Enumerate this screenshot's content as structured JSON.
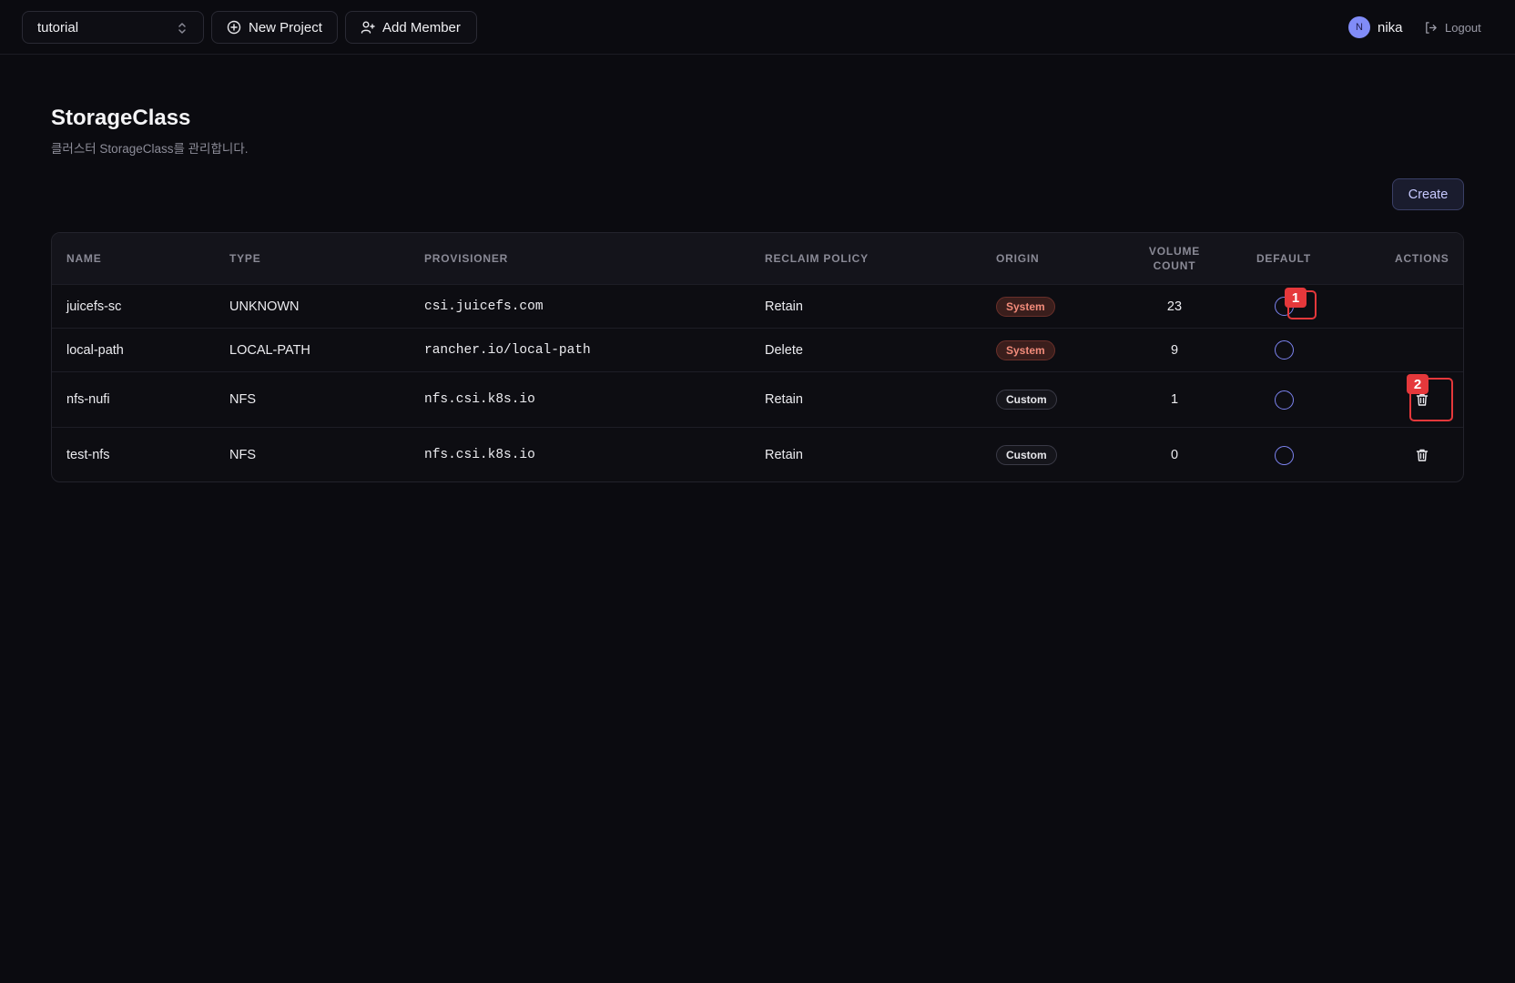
{
  "topbar": {
    "project_select": "tutorial",
    "new_project_label": "New Project",
    "add_member_label": "Add Member",
    "user_initial": "N",
    "user_name": "nika",
    "logout_label": "Logout"
  },
  "page": {
    "title": "StorageClass",
    "subtitle": "클러스터 StorageClass를 관리합니다.",
    "create_label": "Create"
  },
  "table": {
    "headers": {
      "name": "NAME",
      "type": "TYPE",
      "provisioner": "PROVISIONER",
      "reclaim_policy": "RECLAIM POLICY",
      "origin": "ORIGIN",
      "volume_count_line1": "VOLUME",
      "volume_count_line2": "COUNT",
      "default": "DEFAULT",
      "actions": "ACTIONS"
    },
    "rows": [
      {
        "name": "juicefs-sc",
        "type": "UNKNOWN",
        "provisioner": "csi.juicefs.com",
        "reclaim_policy": "Retain",
        "origin": "System",
        "volume_count": "23",
        "deletable": false
      },
      {
        "name": "local-path",
        "type": "LOCAL-PATH",
        "provisioner": "rancher.io/local-path",
        "reclaim_policy": "Delete",
        "origin": "System",
        "volume_count": "9",
        "deletable": false
      },
      {
        "name": "nfs-nufi",
        "type": "NFS",
        "provisioner": "nfs.csi.k8s.io",
        "reclaim_policy": "Retain",
        "origin": "Custom",
        "volume_count": "1",
        "deletable": true
      },
      {
        "name": "test-nfs",
        "type": "NFS",
        "provisioner": "nfs.csi.k8s.io",
        "reclaim_policy": "Retain",
        "origin": "Custom",
        "volume_count": "0",
        "deletable": true
      }
    ]
  },
  "annotations": {
    "mark1": "1",
    "mark2": "2"
  },
  "colors": {
    "background": "#0b0b10",
    "accent": "#818cf8",
    "system_badge": "#f28b7a",
    "annotation": "#e5383b"
  },
  "icons": [
    "chevron-updown-icon",
    "plus-circle-icon",
    "user-plus-icon",
    "logout-icon",
    "trash-icon"
  ]
}
